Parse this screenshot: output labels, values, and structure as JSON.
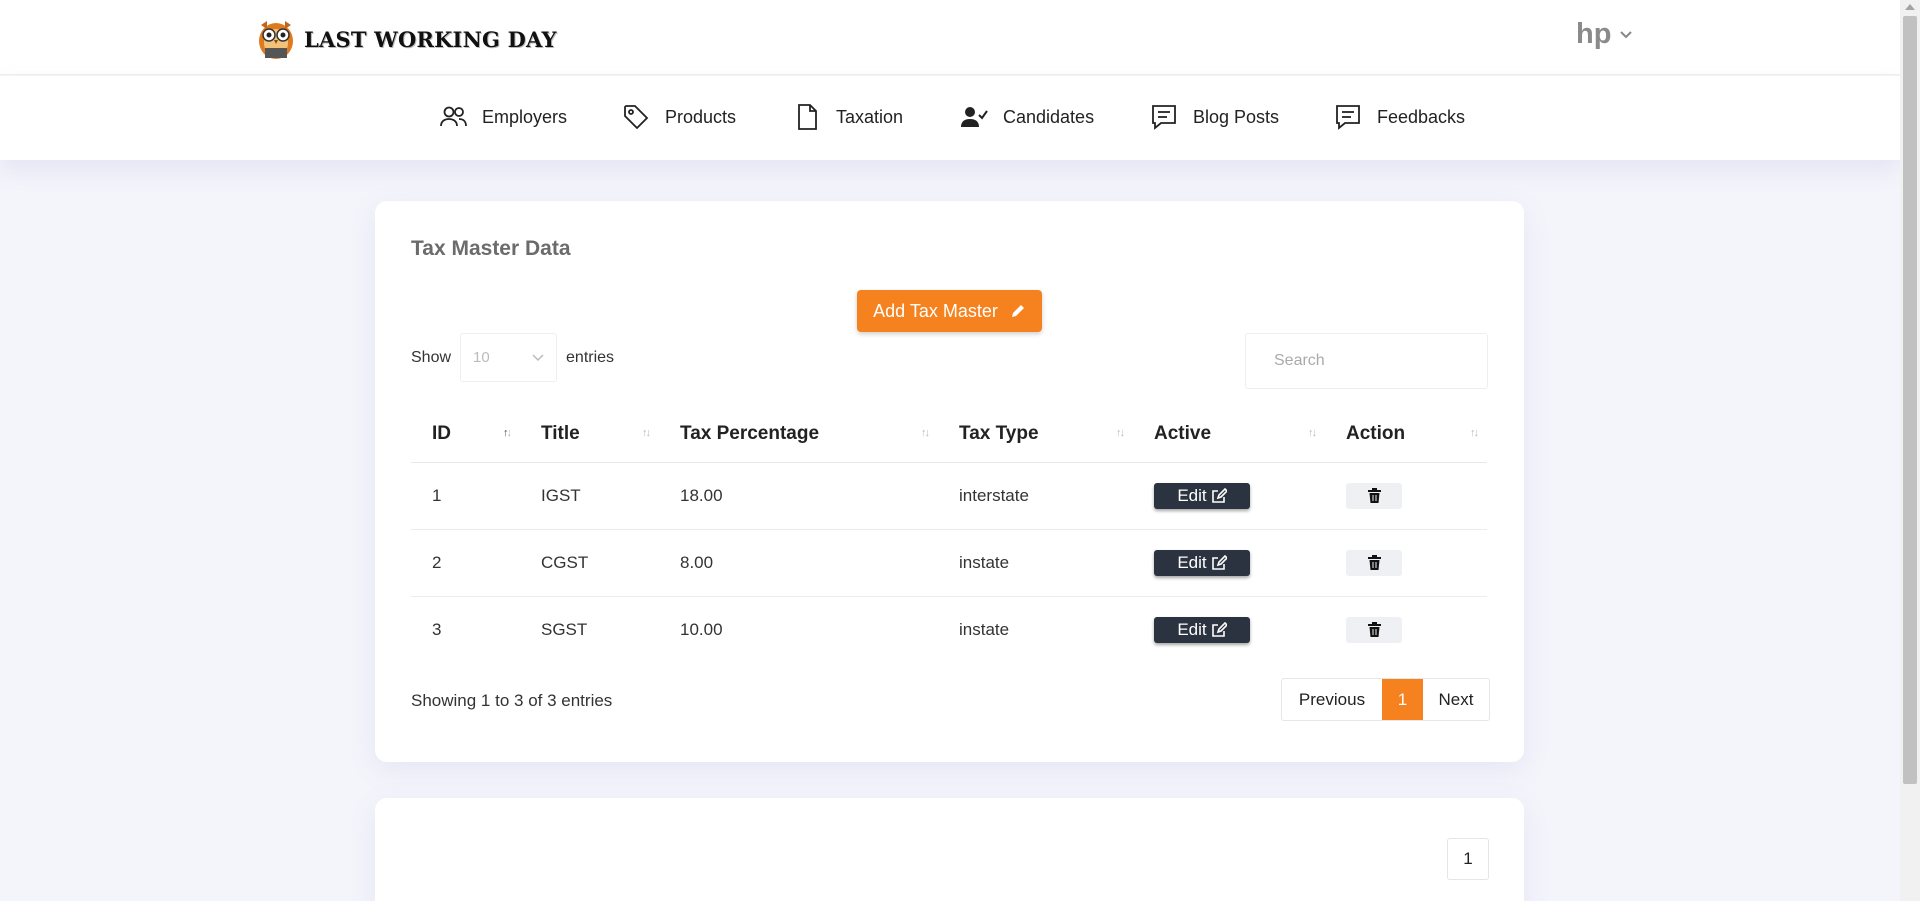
{
  "brand": {
    "name": "LAST WORKING DAY",
    "icon": "owl-logo-icon"
  },
  "user": {
    "name": "hp",
    "icon": "chevron-down-icon"
  },
  "nav": [
    {
      "label": "Employers",
      "icon": "users-icon"
    },
    {
      "label": "Products",
      "icon": "tag-icon"
    },
    {
      "label": "Taxation",
      "icon": "file-icon"
    },
    {
      "label": "Candidates",
      "icon": "user-check-icon"
    },
    {
      "label": "Blog Posts",
      "icon": "message-icon"
    },
    {
      "label": "Feedbacks",
      "icon": "message-icon"
    }
  ],
  "page": {
    "title": "Tax Master Data",
    "add_button": "Add Tax Master",
    "show_label": "Show",
    "entries_label": "entries",
    "length_value": "10",
    "search_placeholder": "Search"
  },
  "table": {
    "headers": [
      "ID",
      "Title",
      "Tax Percentage",
      "Tax Type",
      "Active",
      "Action"
    ],
    "rows": [
      {
        "id": "1",
        "title": "IGST",
        "percentage": "18.00",
        "type": "interstate",
        "edit": "Edit"
      },
      {
        "id": "2",
        "title": "CGST",
        "percentage": "8.00",
        "type": "instate",
        "edit": "Edit"
      },
      {
        "id": "3",
        "title": "SGST",
        "percentage": "10.00",
        "type": "instate",
        "edit": "Edit"
      }
    ]
  },
  "footer": {
    "info": "Showing 1 to 3 of 3 entries",
    "prev": "Previous",
    "current": "1",
    "next": "Next"
  },
  "bottom_card": {
    "page": "1"
  },
  "colors": {
    "accent": "#f5821f",
    "dark_button": "#2b3240",
    "background": "#f4f4fb"
  }
}
